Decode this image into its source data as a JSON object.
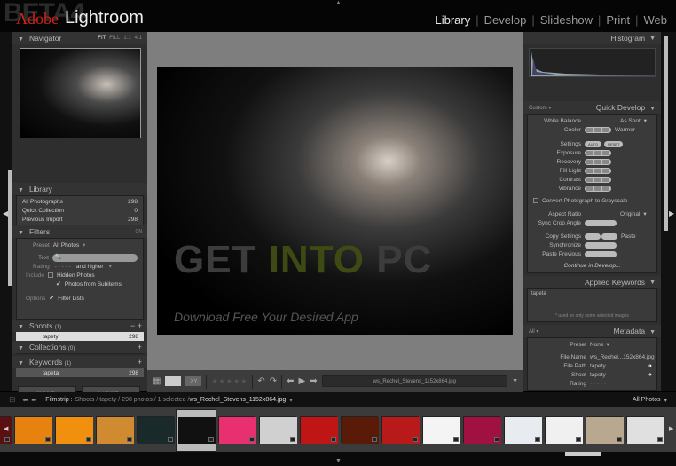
{
  "app": {
    "beta_label": "BETA4",
    "brand_adobe": "Adobe",
    "brand_product": "Lightroom"
  },
  "modules": [
    {
      "label": "Library",
      "active": true
    },
    {
      "label": "Develop",
      "active": false
    },
    {
      "label": "Slideshow",
      "active": false
    },
    {
      "label": "Print",
      "active": false
    },
    {
      "label": "Web",
      "active": false
    }
  ],
  "navigator": {
    "title": "Navigator",
    "options": [
      "FIT",
      "FILL",
      "1:1",
      "4:1"
    ],
    "active_option": "FIT"
  },
  "library": {
    "title": "Library",
    "items": [
      {
        "label": "All Photographs",
        "count": "298"
      },
      {
        "label": "Quick Collection",
        "count": "0"
      },
      {
        "label": "Previous Import",
        "count": "298"
      }
    ]
  },
  "filters": {
    "title": "Filters",
    "toggle": "ON",
    "preset_label": "Preset",
    "preset_value": "All Photos",
    "text_label": "Text",
    "text_value": "",
    "rating_label": "Rating",
    "rating_stars": "- - - - -",
    "rating_mode": "and higher",
    "include_label": "Include",
    "hidden_photos": {
      "label": "Hidden Photos",
      "checked": false
    },
    "subitems": {
      "label": "Photos from Subitems",
      "checked": true
    },
    "options_label": "Options",
    "filter_lists": {
      "label": "Filter Lists",
      "checked": true
    }
  },
  "shoots": {
    "title": "Shoots",
    "count": "(1)",
    "items": [
      {
        "label": "tapety",
        "count": "298"
      }
    ]
  },
  "collections": {
    "title": "Collections",
    "count": "(0)"
  },
  "keywords": {
    "title": "Keywords",
    "count": "(1)",
    "items": [
      {
        "label": "tapeta",
        "count": "298"
      }
    ]
  },
  "left_buttons": {
    "import": "Import...",
    "export": "Export..."
  },
  "watermark": {
    "get": "GET",
    "into": "INTO",
    "pc": "PC",
    "tagline": "Download Free Your Desired App"
  },
  "toolbar": {
    "filename": "ws_Rechel_Stevens_1152x864.jpg",
    "stars": "★★★★★"
  },
  "histogram": {
    "title": "Histogram"
  },
  "quick_develop": {
    "title": "Quick Develop",
    "preset": "Custom",
    "white_balance_label": "White Balance",
    "white_balance_value": "As Shot",
    "cooler": "Cooler",
    "warmer": "Warmer",
    "settings_label": "Settings",
    "auto": "AUTO",
    "reset": "RESET",
    "controls": [
      "Exposure",
      "Recovery",
      "Fill Light",
      "Contrast",
      "Vibrance"
    ],
    "grayscale": "Convert Photograph to Grayscale",
    "aspect_label": "Aspect Ratio",
    "aspect_value": "Original",
    "sync_crop": "Sync Crop Angle",
    "copy_settings": "Copy Settings",
    "paste": "Paste",
    "synchronize": "Synchronize",
    "paste_previous": "Paste Previous",
    "continue": "Continue in Develop..."
  },
  "applied_keywords": {
    "title": "Applied Keywords",
    "value": "tapeta",
    "note": "* used on only some selected images"
  },
  "metadata": {
    "title": "Metadata",
    "filter": "All",
    "preset_label": "Preset",
    "preset_value": "None",
    "fields": [
      {
        "label": "File Name",
        "value": "ws_Rechel...152x864.jpg"
      },
      {
        "label": "File Path",
        "value": "tapety"
      },
      {
        "label": "Shoot",
        "value": "tapety"
      }
    ],
    "rating_label": "Rating",
    "rating_value": "· · · · ·"
  },
  "filmstrip": {
    "label": "Filmstrip :",
    "path": "Shoots / tapety / 298 photos / 1 selected / ",
    "selected_file": "ws_Rechel_Stevens_1152x864.jpg",
    "filter": "All Photos",
    "thumb_colors": [
      "#5a1010",
      "#e8820e",
      "#f0900e",
      "#d08a30",
      "#1a2a2a",
      "#111111",
      "#e83070",
      "#d0d0d0",
      "#c01515",
      "#5a1a08",
      "#b81a1a",
      "#f4f4f4",
      "#a01040",
      "#e8ecf0",
      "#f0f0f0",
      "#b8a890",
      "#e0e0e0"
    ],
    "selected_index": 5
  }
}
